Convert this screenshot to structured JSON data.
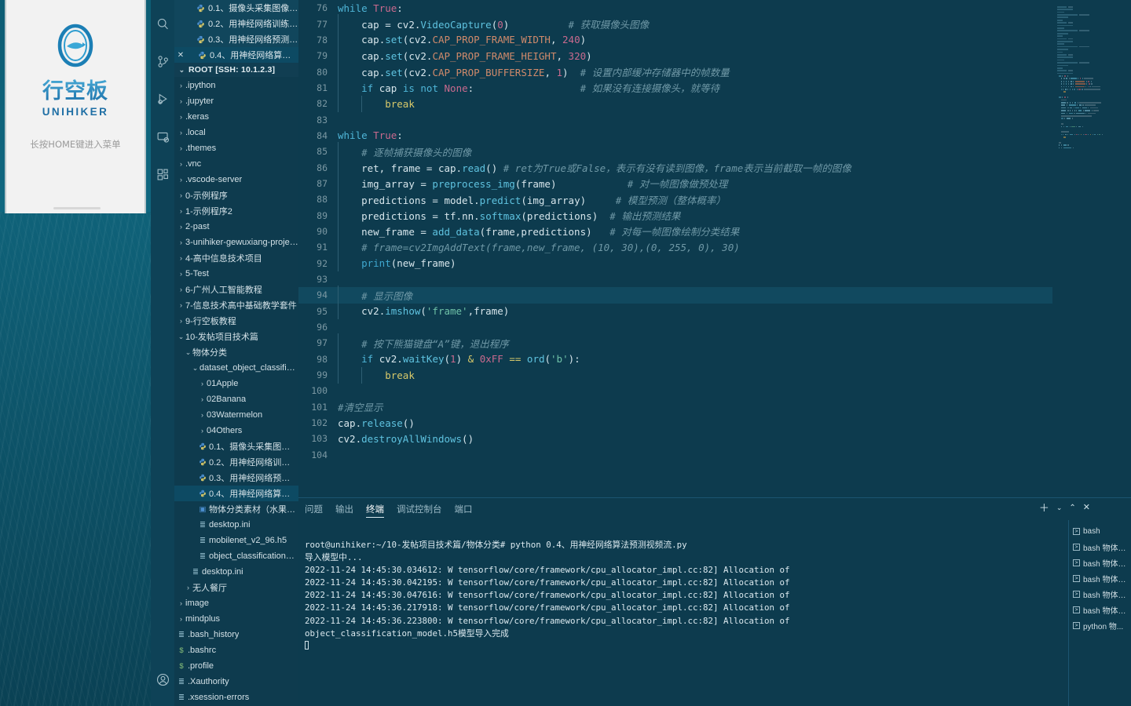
{
  "device": {
    "brand_cn": "行空板",
    "brand_en": "UNIHIKER",
    "hint": "长按HOME键进入菜单"
  },
  "activitybar": {
    "icons": [
      "search-icon",
      "source-control-icon",
      "run-debug-icon",
      "remote-explorer-icon",
      "extensions-icon",
      "account-icon"
    ]
  },
  "sidebar": {
    "open_editors": [
      {
        "label": "0.1、摄像头采集图像.py 1...",
        "closable": false,
        "selected": false
      },
      {
        "label": "0.2、用神经网络训练物体...",
        "closable": false,
        "selected": false
      },
      {
        "label": "0.3、用神经网络预测单张...",
        "closable": false,
        "selected": false
      },
      {
        "label": "0.4、用神经网络算法预测...",
        "closable": true,
        "selected": true
      }
    ],
    "root_label": "ROOT [SSH: 10.1.2.3]",
    "tree": [
      {
        "label": ".ipython",
        "depth": 0,
        "type": "folder",
        "state": "collapsed"
      },
      {
        "label": ".jupyter",
        "depth": 0,
        "type": "folder",
        "state": "collapsed"
      },
      {
        "label": ".keras",
        "depth": 0,
        "type": "folder",
        "state": "collapsed"
      },
      {
        "label": ".local",
        "depth": 0,
        "type": "folder",
        "state": "collapsed"
      },
      {
        "label": ".themes",
        "depth": 0,
        "type": "folder",
        "state": "collapsed"
      },
      {
        "label": ".vnc",
        "depth": 0,
        "type": "folder",
        "state": "collapsed"
      },
      {
        "label": ".vscode-server",
        "depth": 0,
        "type": "folder",
        "state": "collapsed"
      },
      {
        "label": "0-示例程序",
        "depth": 0,
        "type": "folder",
        "state": "collapsed"
      },
      {
        "label": "1-示例程序2",
        "depth": 0,
        "type": "folder",
        "state": "collapsed"
      },
      {
        "label": "2-past",
        "depth": 0,
        "type": "folder",
        "state": "collapsed"
      },
      {
        "label": "3-unihiker-gewuxiang-projects-...",
        "depth": 0,
        "type": "folder",
        "state": "collapsed"
      },
      {
        "label": "4-高中信息技术项目",
        "depth": 0,
        "type": "folder",
        "state": "collapsed"
      },
      {
        "label": "5-Test",
        "depth": 0,
        "type": "folder",
        "state": "collapsed"
      },
      {
        "label": "6-广州人工智能教程",
        "depth": 0,
        "type": "folder",
        "state": "collapsed"
      },
      {
        "label": "7-信息技术高中基础教学套件",
        "depth": 0,
        "type": "folder",
        "state": "collapsed"
      },
      {
        "label": "9-行空板教程",
        "depth": 0,
        "type": "folder",
        "state": "collapsed"
      },
      {
        "label": "10-发帖项目技术篇",
        "depth": 0,
        "type": "folder",
        "state": "expanded"
      },
      {
        "label": "物体分类",
        "depth": 1,
        "type": "folder",
        "state": "expanded"
      },
      {
        "label": "dataset_object_classification",
        "depth": 2,
        "type": "folder",
        "state": "expanded"
      },
      {
        "label": "01Apple",
        "depth": 3,
        "type": "folder",
        "state": "collapsed"
      },
      {
        "label": "02Banana",
        "depth": 3,
        "type": "folder",
        "state": "collapsed"
      },
      {
        "label": "03Watermelon",
        "depth": 3,
        "type": "folder",
        "state": "collapsed"
      },
      {
        "label": "04Others",
        "depth": 3,
        "type": "folder",
        "state": "collapsed"
      },
      {
        "label": "0.1、摄像头采集图像.py",
        "depth": 3,
        "type": "python"
      },
      {
        "label": "0.2、用神经网络训练物体模...",
        "depth": 3,
        "type": "python"
      },
      {
        "label": "0.3、用神经网络预测单张图...",
        "depth": 3,
        "type": "python"
      },
      {
        "label": "0.4、用神经网络算法预测视...",
        "depth": 3,
        "type": "python",
        "selected": true
      },
      {
        "label": "物体分类素材（水果）.docx",
        "depth": 3,
        "type": "docx"
      },
      {
        "label": "desktop.ini",
        "depth": 3,
        "type": "ini"
      },
      {
        "label": "mobilenet_v2_96.h5",
        "depth": 3,
        "type": "ini"
      },
      {
        "label": "object_classification_model.h5",
        "depth": 3,
        "type": "ini"
      },
      {
        "label": "desktop.ini",
        "depth": 2,
        "type": "ini"
      },
      {
        "label": "无人餐厅",
        "depth": 1,
        "type": "folder",
        "state": "collapsed"
      },
      {
        "label": "image",
        "depth": 0,
        "type": "folder",
        "state": "collapsed"
      },
      {
        "label": "mindplus",
        "depth": 0,
        "type": "folder",
        "state": "collapsed"
      },
      {
        "label": ".bash_history",
        "depth": 0,
        "type": "ini"
      },
      {
        "label": ".bashrc",
        "depth": 0,
        "type": "sh"
      },
      {
        "label": ".profile",
        "depth": 0,
        "type": "sh"
      },
      {
        "label": ".Xauthority",
        "depth": 0,
        "type": "ini"
      },
      {
        "label": ".xsession-errors",
        "depth": 0,
        "type": "ini"
      }
    ]
  },
  "editor": {
    "first_line_number": 76,
    "active_line_number": 94,
    "lines": [
      {
        "n": 76,
        "indent": 0,
        "tokens": [
          [
            "kw",
            "while"
          ],
          [
            "op",
            " "
          ],
          [
            "const",
            "True"
          ],
          [
            "op",
            ":"
          ]
        ]
      },
      {
        "n": 77,
        "indent": 1,
        "tokens": [
          [
            "var",
            "cap"
          ],
          [
            "op",
            " = "
          ],
          [
            "var",
            "cv2"
          ],
          [
            "op",
            "."
          ],
          [
            "fn",
            "VideoCapture"
          ],
          [
            "op",
            "("
          ],
          [
            "num",
            "0"
          ],
          [
            "op",
            ")"
          ],
          [
            "cmt",
            "          # 获取摄像头图像"
          ]
        ]
      },
      {
        "n": 78,
        "indent": 1,
        "tokens": [
          [
            "var",
            "cap"
          ],
          [
            "op",
            "."
          ],
          [
            "fn",
            "set"
          ],
          [
            "op",
            "("
          ],
          [
            "var",
            "cv2"
          ],
          [
            "op",
            "."
          ],
          [
            "prop",
            "CAP_PROP_FRAME_WIDTH"
          ],
          [
            "op",
            ", "
          ],
          [
            "num",
            "240"
          ],
          [
            "op",
            ")"
          ]
        ]
      },
      {
        "n": 79,
        "indent": 1,
        "tokens": [
          [
            "var",
            "cap"
          ],
          [
            "op",
            "."
          ],
          [
            "fn",
            "set"
          ],
          [
            "op",
            "("
          ],
          [
            "var",
            "cv2"
          ],
          [
            "op",
            "."
          ],
          [
            "prop",
            "CAP_PROP_FRAME_HEIGHT"
          ],
          [
            "op",
            ", "
          ],
          [
            "num",
            "320"
          ],
          [
            "op",
            ")"
          ]
        ]
      },
      {
        "n": 80,
        "indent": 1,
        "tokens": [
          [
            "var",
            "cap"
          ],
          [
            "op",
            "."
          ],
          [
            "fn",
            "set"
          ],
          [
            "op",
            "("
          ],
          [
            "var",
            "cv2"
          ],
          [
            "op",
            "."
          ],
          [
            "prop",
            "CAP_PROP_BUFFERSIZE"
          ],
          [
            "op",
            ", "
          ],
          [
            "num",
            "1"
          ],
          [
            "op",
            ")"
          ],
          [
            "cmt",
            "  # 设置内部缓冲存储器中的帧数量"
          ]
        ]
      },
      {
        "n": 81,
        "indent": 1,
        "tokens": [
          [
            "kw",
            "if"
          ],
          [
            "op",
            " "
          ],
          [
            "var",
            "cap"
          ],
          [
            "op",
            " "
          ],
          [
            "kw",
            "is"
          ],
          [
            "op",
            " "
          ],
          [
            "kw",
            "not"
          ],
          [
            "op",
            " "
          ],
          [
            "const",
            "None"
          ],
          [
            "op",
            ":"
          ],
          [
            "cmt",
            "                  # 如果没有连接摄像头，就等待"
          ]
        ]
      },
      {
        "n": 82,
        "indent": 2,
        "tokens": [
          [
            "bi",
            "break"
          ]
        ]
      },
      {
        "n": 83,
        "indent": 0,
        "tokens": []
      },
      {
        "n": 84,
        "indent": 0,
        "tokens": [
          [
            "kw",
            "while"
          ],
          [
            "op",
            " "
          ],
          [
            "const",
            "True"
          ],
          [
            "op",
            ":"
          ]
        ]
      },
      {
        "n": 85,
        "indent": 1,
        "tokens": [
          [
            "cmt",
            "# 逐帧捕获摄像头的图像"
          ]
        ]
      },
      {
        "n": 86,
        "indent": 1,
        "tokens": [
          [
            "var",
            "ret, frame"
          ],
          [
            "op",
            " = "
          ],
          [
            "var",
            "cap"
          ],
          [
            "op",
            "."
          ],
          [
            "fn",
            "read"
          ],
          [
            "op",
            "()"
          ],
          [
            "cmt",
            " # ret为True或False，表示有没有读到图像，frame表示当前截取一帧的图像"
          ]
        ]
      },
      {
        "n": 87,
        "indent": 1,
        "tokens": [
          [
            "var",
            "img_array"
          ],
          [
            "op",
            " = "
          ],
          [
            "fn",
            "preprocess_img"
          ],
          [
            "op",
            "("
          ],
          [
            "var",
            "frame"
          ],
          [
            "op",
            ")"
          ],
          [
            "cmt",
            "            # 对一帧图像做预处理"
          ]
        ]
      },
      {
        "n": 88,
        "indent": 1,
        "tokens": [
          [
            "var",
            "predictions"
          ],
          [
            "op",
            " = "
          ],
          [
            "var",
            "model"
          ],
          [
            "op",
            "."
          ],
          [
            "fn",
            "predict"
          ],
          [
            "op",
            "("
          ],
          [
            "var",
            "img_array"
          ],
          [
            "op",
            ")"
          ],
          [
            "cmt",
            "     # 模型预测（整体概率）"
          ]
        ]
      },
      {
        "n": 89,
        "indent": 1,
        "tokens": [
          [
            "var",
            "predictions"
          ],
          [
            "op",
            " = "
          ],
          [
            "var",
            "tf"
          ],
          [
            "op",
            "."
          ],
          [
            "var",
            "nn"
          ],
          [
            "op",
            "."
          ],
          [
            "fn",
            "softmax"
          ],
          [
            "op",
            "("
          ],
          [
            "var",
            "predictions"
          ],
          [
            "op",
            ")"
          ],
          [
            "cmt",
            "  # 输出预测结果"
          ]
        ]
      },
      {
        "n": 90,
        "indent": 1,
        "tokens": [
          [
            "var",
            "new_frame"
          ],
          [
            "op",
            " = "
          ],
          [
            "fn",
            "add_data"
          ],
          [
            "op",
            "("
          ],
          [
            "var",
            "frame,predictions"
          ],
          [
            "op",
            ")"
          ],
          [
            "cmt",
            "   # 对每一帧图像绘制分类结果"
          ]
        ]
      },
      {
        "n": 91,
        "indent": 1,
        "tokens": [
          [
            "cmt",
            "# frame=cv2ImgAddText(frame,new_frame, (10, 30),(0, 255, 0), 30)"
          ]
        ]
      },
      {
        "n": 92,
        "indent": 1,
        "tokens": [
          [
            "kw2",
            "print"
          ],
          [
            "op",
            "("
          ],
          [
            "var",
            "new_frame"
          ],
          [
            "op",
            ")"
          ]
        ]
      },
      {
        "n": 93,
        "indent": 0,
        "tokens": []
      },
      {
        "n": 94,
        "indent": 1,
        "tokens": [
          [
            "cmt",
            "# 显示图像"
          ]
        ]
      },
      {
        "n": 95,
        "indent": 1,
        "tokens": [
          [
            "var",
            "cv2"
          ],
          [
            "op",
            "."
          ],
          [
            "fn",
            "imshow"
          ],
          [
            "op",
            "("
          ],
          [
            "str",
            "'frame'"
          ],
          [
            "op",
            ","
          ],
          [
            "var",
            "frame"
          ],
          [
            "op",
            ")"
          ]
        ]
      },
      {
        "n": 96,
        "indent": 0,
        "tokens": []
      },
      {
        "n": 97,
        "indent": 1,
        "tokens": [
          [
            "cmt",
            "# 按下熊猫键盘“A”键，退出程序"
          ]
        ]
      },
      {
        "n": 98,
        "indent": 1,
        "tokens": [
          [
            "kw",
            "if"
          ],
          [
            "op",
            " "
          ],
          [
            "var",
            "cv2"
          ],
          [
            "op",
            "."
          ],
          [
            "fn",
            "waitKey"
          ],
          [
            "op",
            "("
          ],
          [
            "num",
            "1"
          ],
          [
            "op",
            ") "
          ],
          [
            "bi",
            "&"
          ],
          [
            "op",
            " "
          ],
          [
            "num",
            "0xFF"
          ],
          [
            "op",
            " "
          ],
          [
            "bi",
            "=="
          ],
          [
            "op",
            " "
          ],
          [
            "fn",
            "ord"
          ],
          [
            "op",
            "("
          ],
          [
            "str",
            "'b'"
          ],
          [
            "op",
            "):"
          ]
        ]
      },
      {
        "n": 99,
        "indent": 2,
        "tokens": [
          [
            "bi",
            "break"
          ]
        ]
      },
      {
        "n": 100,
        "indent": 0,
        "tokens": []
      },
      {
        "n": 101,
        "indent": 0,
        "tokens": [
          [
            "cmt",
            "#清空显示"
          ]
        ]
      },
      {
        "n": 102,
        "indent": 0,
        "tokens": [
          [
            "var",
            "cap"
          ],
          [
            "op",
            "."
          ],
          [
            "fn",
            "release"
          ],
          [
            "op",
            "()"
          ]
        ]
      },
      {
        "n": 103,
        "indent": 0,
        "tokens": [
          [
            "var",
            "cv2"
          ],
          [
            "op",
            "."
          ],
          [
            "fn",
            "destroyAllWindows"
          ],
          [
            "op",
            "()"
          ]
        ]
      },
      {
        "n": 104,
        "indent": 0,
        "tokens": []
      }
    ]
  },
  "panel": {
    "tabs": [
      {
        "label": "问题",
        "active": false
      },
      {
        "label": "输出",
        "active": false
      },
      {
        "label": "终端",
        "active": true
      },
      {
        "label": "调试控制台",
        "active": false
      },
      {
        "label": "端口",
        "active": false
      }
    ],
    "actions": [
      "add-terminal-icon",
      "chevron-down-icon",
      "chevron-up-icon",
      "close-icon"
    ],
    "terminal_output": [
      "root@unihiker:~/10-发帖项目技术篇/物体分类# python 0.4、用神经网络算法预测视频流.py",
      "导入模型中...",
      "2022-11-24 14:45:30.034612: W tensorflow/core/framework/cpu_allocator_impl.cc:82] Allocation of",
      "2022-11-24 14:45:30.042195: W tensorflow/core/framework/cpu_allocator_impl.cc:82] Allocation of",
      "2022-11-24 14:45:30.047616: W tensorflow/core/framework/cpu_allocator_impl.cc:82] Allocation of",
      "2022-11-24 14:45:36.217918: W tensorflow/core/framework/cpu_allocator_impl.cc:82] Allocation of",
      "2022-11-24 14:45:36.223800: W tensorflow/core/framework/cpu_allocator_impl.cc:82] Allocation of",
      "object_classification_model.h5模型导入完成"
    ],
    "terminal_list": [
      {
        "label": "bash"
      },
      {
        "label": "bash 物体分..."
      },
      {
        "label": "bash 物体分..."
      },
      {
        "label": "bash 物体分..."
      },
      {
        "label": "bash 物体分..."
      },
      {
        "label": "bash 物体分..."
      },
      {
        "label": "python 物..."
      }
    ]
  },
  "colors": {
    "editor_bg": "#0d3b4e",
    "sidebar_bg": "#0e3b4e",
    "activitybar_bg": "#0e4257",
    "accent": "#4fb6d8",
    "selection": "#0d4a63"
  }
}
